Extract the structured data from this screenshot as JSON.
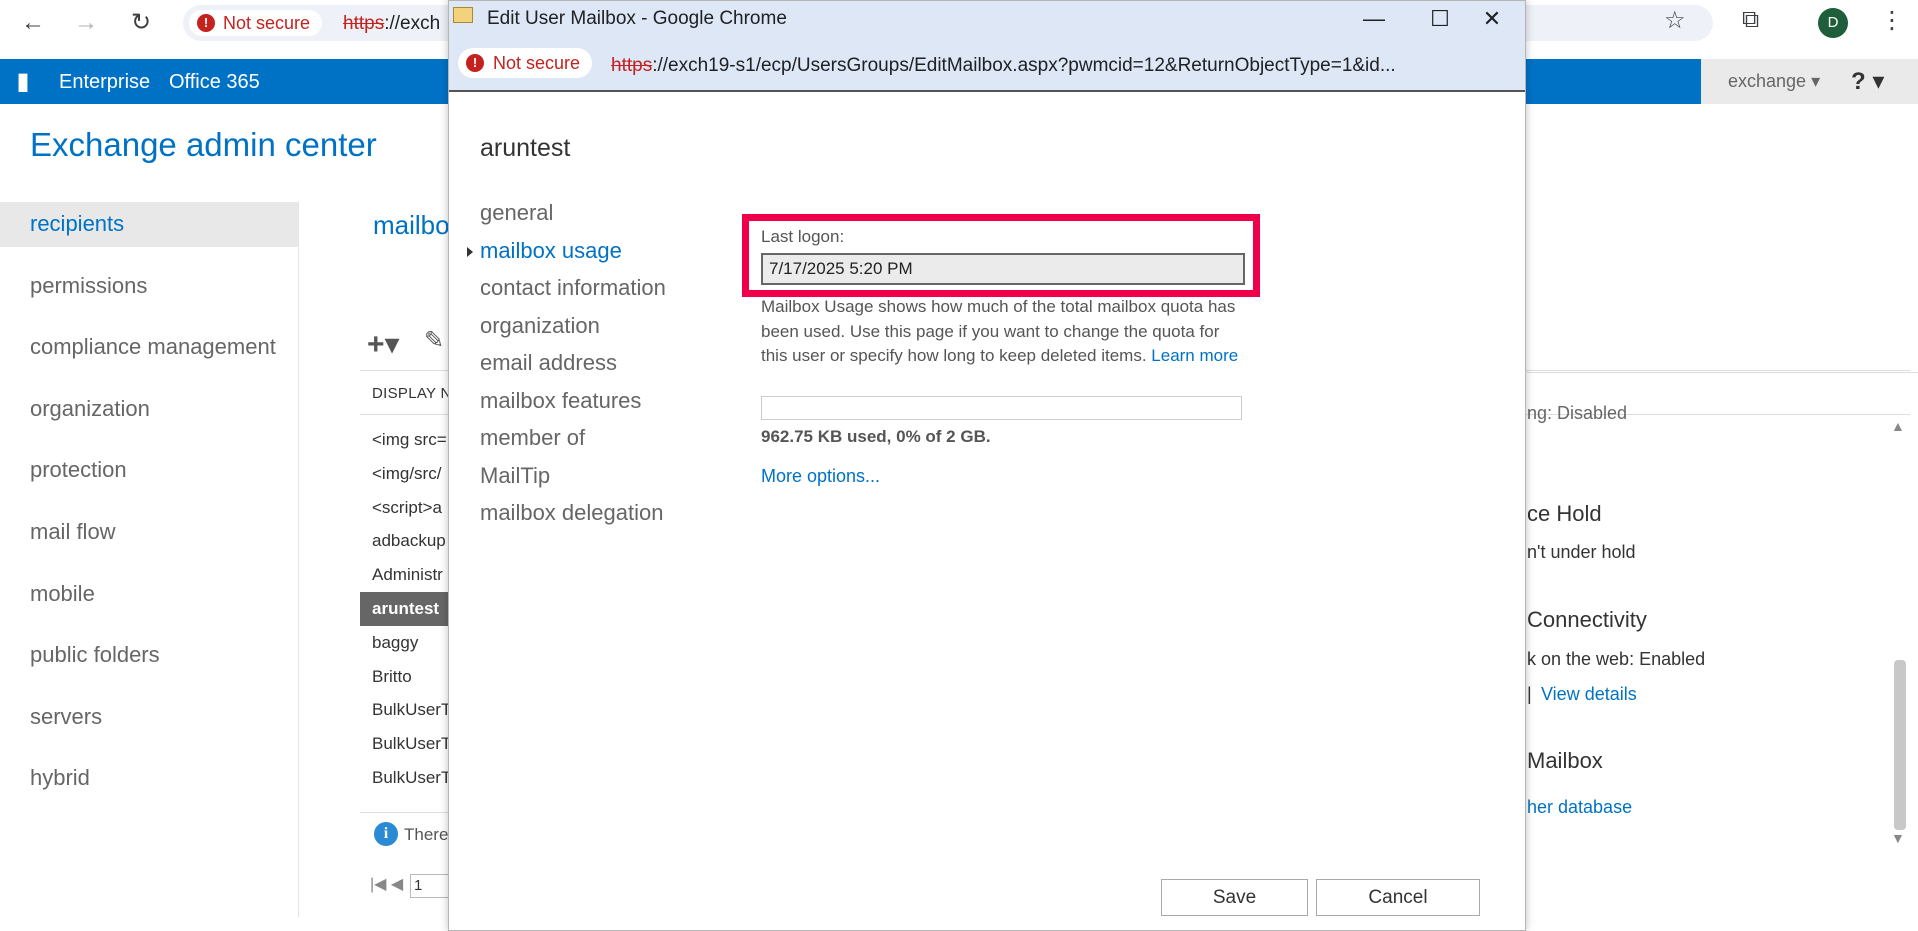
{
  "browser": {
    "back": "←",
    "forward": "→",
    "reload": "↻",
    "not_secure": "Not secure",
    "url_proto": "https",
    "url_rest": "://exch",
    "star": "☆",
    "extensions": "⧉",
    "menu": "⋮",
    "profile_initial": "D"
  },
  "o365": {
    "logo": "▮",
    "enterprise": "Enterprise",
    "office365": "Office 365",
    "user": "exchange ▾",
    "help": "? ▾"
  },
  "eac": {
    "title": "Exchange admin center",
    "nav": [
      {
        "label": "recipients",
        "selected": true
      },
      {
        "label": "permissions"
      },
      {
        "label": "compliance management"
      },
      {
        "label": "organization"
      },
      {
        "label": "protection"
      },
      {
        "label": "mail flow"
      },
      {
        "label": "mobile"
      },
      {
        "label": "public folders"
      },
      {
        "label": "servers"
      },
      {
        "label": "hybrid"
      }
    ],
    "heading": "mailbo",
    "toolbar_add": "+▾",
    "toolbar_edit": "✎",
    "list_header": "DISPLAY N",
    "rows": [
      "<img src=",
      "<img/src/",
      "<script>a",
      "adbackup",
      "Administr",
      "aruntest",
      "baggy",
      "Britto",
      "BulkUserT",
      "BulkUserT",
      "BulkUserT",
      "BulkUserT"
    ],
    "selected_row": 5,
    "info_text": "There",
    "info_icon": "i",
    "pager_arrows": "|◀ ◀",
    "pager_value": "1"
  },
  "details": {
    "disabled_text": "ng:  Disabled",
    "hold_head": "ce Hold",
    "hold_text": "n't under hold",
    "conn_head": "Connectivity",
    "owa_text": "k on the web:  Enabled",
    "view_sep": "|",
    "view_details": "View details",
    "mbx_head": "Mailbox",
    "other_db": "her database",
    "scroll_up": "▲",
    "scroll_down": "▼"
  },
  "popup": {
    "title": "Edit User Mailbox - Google Chrome",
    "minimize": "—",
    "maximize": "☐",
    "close": "✕",
    "not_secure": "Not secure",
    "url_proto": "https",
    "url_rest": "://exch19-s1/ecp/UsersGroups/EditMailbox.aspx?pwmcid=12&ReturnObjectType=1&id...",
    "mailbox_name": "aruntest",
    "nav": [
      {
        "label": "general"
      },
      {
        "label": "mailbox usage",
        "active": true
      },
      {
        "label": "contact information"
      },
      {
        "label": "organization"
      },
      {
        "label": "email address"
      },
      {
        "label": "mailbox features"
      },
      {
        "label": "member of"
      },
      {
        "label": "MailTip"
      },
      {
        "label": "mailbox delegation"
      }
    ],
    "last_logon_label": "Last logon:",
    "last_logon_value": "7/17/2025 5:20 PM",
    "usage_desc": "Mailbox Usage shows how much of the total mailbox quota has been used. Use this page if you want to change the quota for this user or specify how long to keep deleted items.",
    "learn_more": "Learn more",
    "usage_percent": 0,
    "usage_text": "962.75 KB used, 0% of 2 GB.",
    "more_options": "More options...",
    "save": "Save",
    "cancel": "Cancel",
    "highlight_color": "#f0004a"
  }
}
